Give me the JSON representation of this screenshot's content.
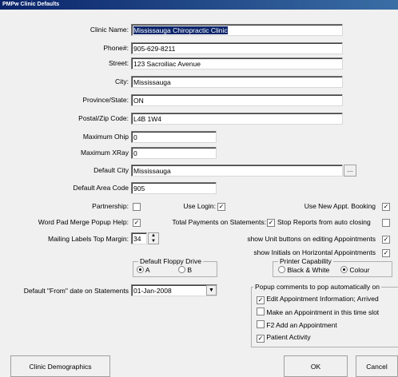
{
  "window": {
    "title": "PMPw Clinic Defaults"
  },
  "fields": {
    "clinic_name_label": "Clinic Name:",
    "clinic_name": "Mississauga Chiropractic Clinic",
    "phone_label": "Phone#:",
    "phone": "905-629-8211",
    "street_label": "Street:",
    "street": "123 Sacroiliac Avenue",
    "city_label": "City:",
    "city": "Mississauga",
    "province_label": "Province/State:",
    "province": "ON",
    "postal_label": "Postal/Zip Code:",
    "postal": "L4B 1W4",
    "max_ohip_label": "Maximum Ohip",
    "max_ohip": "0",
    "max_xray_label": "Maximum XRay",
    "max_xray": "0",
    "default_city_label": "Default City",
    "default_city": "Mississauga",
    "area_code_label": "Default Area Code",
    "area_code": "905",
    "browse_label": "..."
  },
  "options": {
    "partnership": "Partnership:",
    "use_login": "Use Login:",
    "new_appt_booking": "Use New Appt. Booking",
    "word_pad": "Word Pad Merge Popup Help:",
    "total_payments": "Total Payments on Statements:",
    "stop_reports": "Stop Reports from auto closing",
    "mailing_margin_label": "Mailing Labels Top Margin:",
    "mailing_margin": "34",
    "show_unit_buttons": "show Unit buttons on editing Appointments",
    "show_initials": "show Initials on Horizontal Appointments"
  },
  "floppy": {
    "legend": "Default Floppy Drive",
    "a": "A",
    "b": "B"
  },
  "printer": {
    "legend": "Printer Capability",
    "bw": "Black & White",
    "colour": "Colour"
  },
  "from_date": {
    "label": "Default \"From\" date on Statements",
    "value": "01-Jan-2008"
  },
  "popup": {
    "legend": "Popup comments to pop automatically on",
    "items": [
      "Edit Appointment Information; Arrived",
      "Make an Appointment in this time slot",
      "F2 Add an Appointment",
      "Patient Activity"
    ]
  },
  "buttons": {
    "demographics": "Clinic Demographics",
    "ok": "OK",
    "cancel": "Cancel"
  }
}
